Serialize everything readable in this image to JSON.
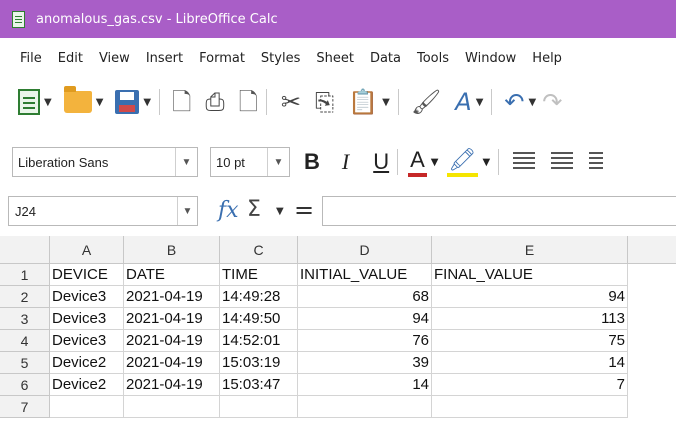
{
  "window": {
    "title": "anomalous_gas.csv - LibreOffice Calc"
  },
  "menu": [
    "File",
    "Edit",
    "View",
    "Insert",
    "Format",
    "Styles",
    "Sheet",
    "Data",
    "Tools",
    "Window",
    "Help"
  ],
  "toolbar": {
    "icons": [
      "new-spreadsheet-icon",
      "open-folder-icon",
      "save-icon",
      "export-pdf-icon",
      "print-icon",
      "print-preview-icon",
      "cut-icon",
      "copy-icon",
      "paste-icon",
      "clone-formatting-icon",
      "clear-formatting-icon",
      "undo-icon",
      "redo-icon"
    ]
  },
  "format": {
    "font_name": "Liberation Sans",
    "font_size": "10 pt",
    "bold": "B",
    "italic": "I",
    "underline": "U",
    "font_color_glyph": "A",
    "font_color": "#c62828",
    "highlight_color": "#f5e500"
  },
  "formula": {
    "name_box": "J24",
    "fx": "fx",
    "sigma": "Σ",
    "equals": "="
  },
  "sheet": {
    "columns": [
      "A",
      "B",
      "C",
      "D",
      "E"
    ],
    "rows": [
      "1",
      "2",
      "3",
      "4",
      "5",
      "6",
      "7"
    ],
    "header": [
      "DEVICE",
      "DATE",
      "TIME",
      "INITIAL_VALUE",
      "FINAL_VALUE"
    ],
    "data": [
      [
        "Device3",
        "2021-04-19",
        "14:49:28",
        "68",
        "94"
      ],
      [
        "Device3",
        "2021-04-19",
        "14:49:50",
        "94",
        "113"
      ],
      [
        "Device3",
        "2021-04-19",
        "14:52:01",
        "76",
        "75"
      ],
      [
        "Device2",
        "2021-04-19",
        "15:03:19",
        "39",
        "14"
      ],
      [
        "Device2",
        "2021-04-19",
        "15:03:47",
        "14",
        "7"
      ]
    ]
  }
}
